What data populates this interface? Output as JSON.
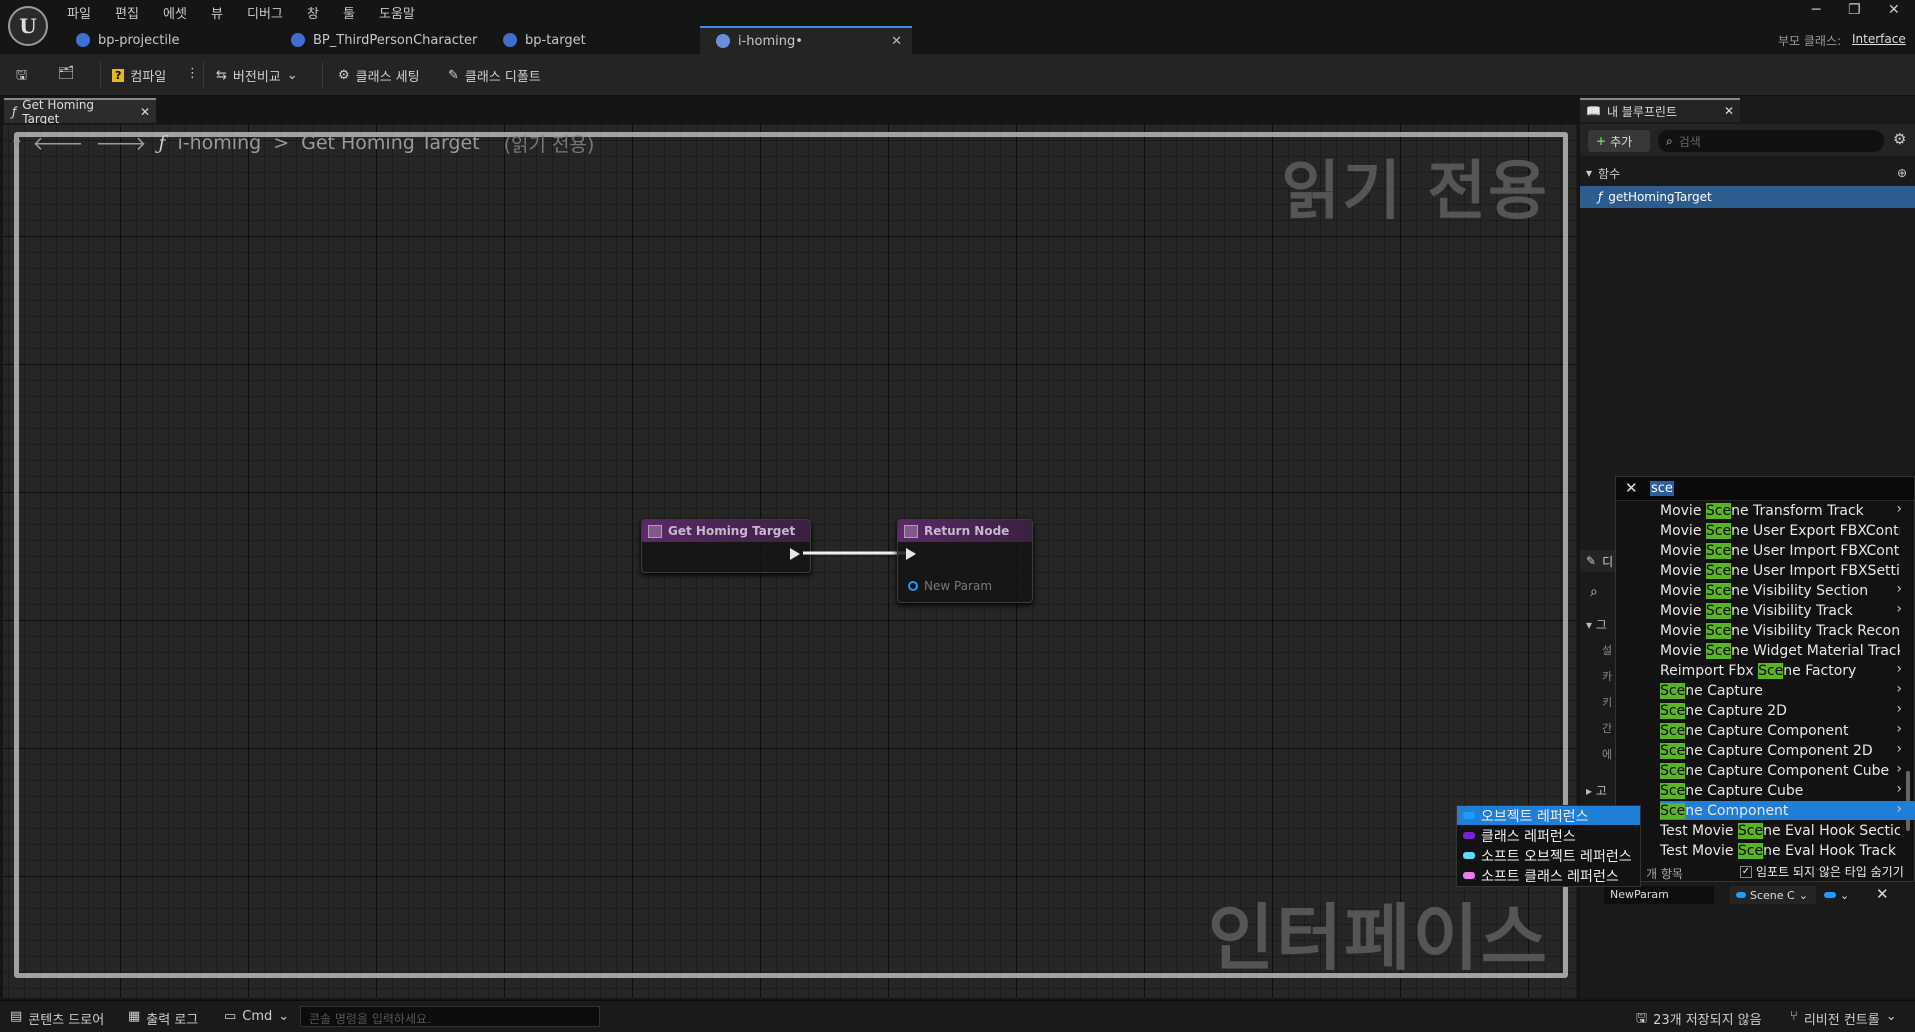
{
  "menu": [
    "파일",
    "편집",
    "에셋",
    "뷰",
    "디버그",
    "창",
    "툴",
    "도움말"
  ],
  "tabs": [
    {
      "label": "bp-projectile"
    },
    {
      "label": "BP_ThirdPersonCharacter"
    },
    {
      "label": "bp-target"
    },
    {
      "label": "i-homing•"
    }
  ],
  "parent_class_label": "부모 클래스:",
  "parent_class_value": "Interface",
  "toolbar": {
    "compile": "컴파일",
    "diff": "버전비교",
    "class_settings": "클래스 세팅",
    "class_defaults": "클래스 디폴트"
  },
  "graph_tab": "Get Homing Target",
  "breadcrumb": {
    "root": "i-homing",
    "sep": ">",
    "func": "Get Homing Target",
    "readonly": "(읽기 전용)"
  },
  "watermark_top": "읽기 전용",
  "watermark_bottom": "인터페이스",
  "nodes": {
    "entry": "Get Homing Target",
    "ret": "Return Node",
    "ret_param": "New Param"
  },
  "my_blueprint": {
    "title": "내 블루프린트",
    "add": "추가",
    "search_placeholder": "검색",
    "functions_header": "함수",
    "function_item": "getHomingTarget"
  },
  "details": {
    "header": "디",
    "labels": [
      "그",
      "설",
      "카",
      "키",
      "간",
      "에",
      "고"
    ]
  },
  "popup": {
    "search": "sce",
    "items": [
      {
        "pre": "Movie ",
        "hl": "Sce",
        "post": "ne Transform Track",
        "arrow": true
      },
      {
        "pre": "Movie ",
        "hl": "Sce",
        "post": "ne User Export FBXContr",
        "arrow": false
      },
      {
        "pre": "Movie ",
        "hl": "Sce",
        "post": "ne User Import FBXContr",
        "arrow": false
      },
      {
        "pre": "Movie ",
        "hl": "Sce",
        "post": "ne User Import FBXSettir",
        "arrow": false
      },
      {
        "pre": "Movie ",
        "hl": "Sce",
        "post": "ne Visibility Section",
        "arrow": true
      },
      {
        "pre": "Movie ",
        "hl": "Sce",
        "post": "ne Visibility Track",
        "arrow": true
      },
      {
        "pre": "Movie ",
        "hl": "Sce",
        "post": "ne Visibility Track Recon",
        "arrow": false
      },
      {
        "pre": "Movie ",
        "hl": "Sce",
        "post": "ne Widget Material Track",
        "arrow": false
      },
      {
        "pre": "Reimport Fbx ",
        "hl": "Sce",
        "post": "ne Factory",
        "arrow": true
      },
      {
        "pre": "",
        "hl": "Sce",
        "post": "ne Capture",
        "arrow": true
      },
      {
        "pre": "",
        "hl": "Sce",
        "post": "ne Capture 2D",
        "arrow": true
      },
      {
        "pre": "",
        "hl": "Sce",
        "post": "ne Capture Component",
        "arrow": true
      },
      {
        "pre": "",
        "hl": "Sce",
        "post": "ne Capture Component 2D",
        "arrow": true
      },
      {
        "pre": "",
        "hl": "Sce",
        "post": "ne Capture Component Cube",
        "arrow": true
      },
      {
        "pre": "",
        "hl": "Sce",
        "post": "ne Capture Cube",
        "arrow": true
      },
      {
        "pre": "",
        "hl": "Sce",
        "post": "ne Component",
        "arrow": true,
        "selected": true
      },
      {
        "pre": "Test Movie ",
        "hl": "Sce",
        "post": "ne Eval Hook Sectic",
        "arrow": false
      },
      {
        "pre": "Test Movie ",
        "hl": "Sce",
        "post": "ne Eval Hook Track",
        "arrow": false
      }
    ],
    "count_label": "개 항목",
    "hide_unloaded": "임포트 되지 않은 타입 숨기기"
  },
  "type_menu": [
    {
      "label": "오브젝트 레퍼런스",
      "color": "#1f9bff"
    },
    {
      "label": "클래스 레퍼런스",
      "color": "#7b21d6"
    },
    {
      "label": "소프트 오브젝트 레퍼런스",
      "color": "#5fd8ff"
    },
    {
      "label": "소프트 클래스 레퍼런스",
      "color": "#f07bf0"
    }
  ],
  "param_row": {
    "name": "NewParam",
    "type": "Scene C"
  },
  "status": {
    "content_drawer": "콘텐츠 드로어",
    "output_log": "출력 로그",
    "cmd": "Cmd",
    "console_placeholder": "콘솔 명령을 입력하세요.",
    "unsaved": "23개 저장되지 않음",
    "revision": "리비전 컨트롤"
  },
  "colors": {
    "accent": "#1f9bff",
    "highlight": "#5ab424"
  }
}
